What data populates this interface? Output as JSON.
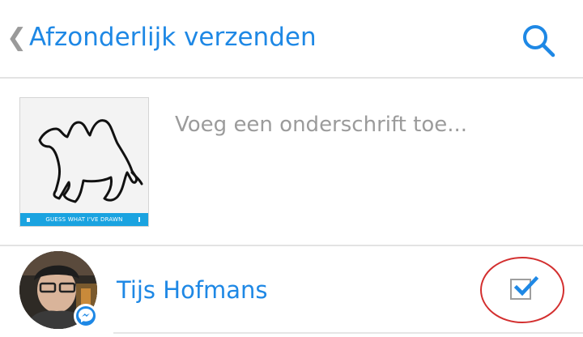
{
  "header": {
    "back_icon": "chevron-left-icon",
    "title": "Afzonderlijk verzenden",
    "search_icon": "search-icon"
  },
  "attachment": {
    "banner_text": "GUESS WHAT I'VE DRAWN"
  },
  "caption": {
    "placeholder": "Voeg een onderschrift toe...",
    "value": ""
  },
  "contacts": [
    {
      "name": "Tijs Hofmans",
      "selected": true,
      "badge_icon": "messenger-icon"
    }
  ],
  "colors": {
    "accent": "#1e88e5",
    "annotation": "#d32f2f"
  }
}
